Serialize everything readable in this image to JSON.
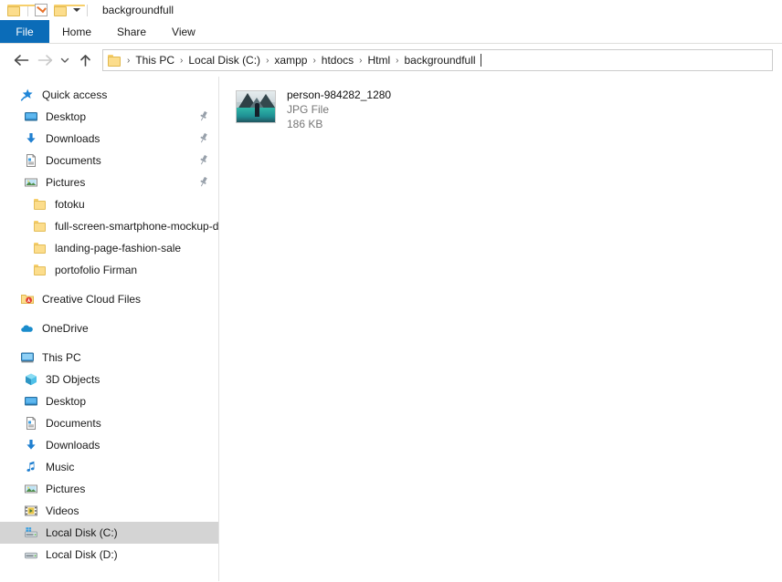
{
  "titlebar": {
    "title": "backgroundfull",
    "quick_access_icons": [
      "folder-icon",
      "properties-checkbox-icon",
      "folder-icon"
    ],
    "customize_label": ""
  },
  "ribbon": {
    "file_tab": "File",
    "tabs": [
      "Home",
      "Share",
      "View"
    ],
    "file_tab_color": "#0b6cb8"
  },
  "address": {
    "back_label": "Back",
    "forward_label": "Forward",
    "recent_label": "Recent locations",
    "up_label": "Up",
    "separator": "›",
    "crumbs": [
      "This PC",
      "Local Disk (C:)",
      "xampp",
      "htdocs",
      "Html",
      "backgroundfull"
    ]
  },
  "sidebar": {
    "quick_access": {
      "label": "Quick access",
      "icon": "star-icon",
      "items": [
        {
          "label": "Desktop",
          "icon": "desktop-icon",
          "pinned": true
        },
        {
          "label": "Downloads",
          "icon": "download-arrow-icon",
          "pinned": true
        },
        {
          "label": "Documents",
          "icon": "document-icon",
          "pinned": true
        },
        {
          "label": "Pictures",
          "icon": "pictures-icon",
          "pinned": true
        },
        {
          "label": "fotoku",
          "icon": "folder-icon",
          "pinned": false
        },
        {
          "label": "full-screen-smartphone-mockup-d",
          "icon": "folder-icon",
          "pinned": false
        },
        {
          "label": "landing-page-fashion-sale",
          "icon": "folder-icon",
          "pinned": false
        },
        {
          "label": "portofolio Firman",
          "icon": "folder-icon",
          "pinned": false
        }
      ]
    },
    "creative_cloud": {
      "label": "Creative Cloud Files",
      "icon": "creative-cloud-folder-icon"
    },
    "onedrive": {
      "label": "OneDrive",
      "icon": "cloud-icon"
    },
    "this_pc": {
      "label": "This PC",
      "icon": "computer-icon",
      "items": [
        {
          "label": "3D Objects",
          "icon": "3d-objects-icon"
        },
        {
          "label": "Desktop",
          "icon": "desktop-icon"
        },
        {
          "label": "Documents",
          "icon": "document-icon"
        },
        {
          "label": "Downloads",
          "icon": "download-arrow-icon"
        },
        {
          "label": "Music",
          "icon": "music-note-icon"
        },
        {
          "label": "Pictures",
          "icon": "pictures-icon"
        },
        {
          "label": "Videos",
          "icon": "videos-icon"
        },
        {
          "label": "Local Disk (C:)",
          "icon": "system-drive-icon",
          "selected": true
        },
        {
          "label": "Local Disk (D:)",
          "icon": "drive-icon",
          "selected": false
        }
      ]
    },
    "selection_color": "#d4d4d4"
  },
  "content": {
    "files": [
      {
        "name": "person-984282_1280",
        "type": "JPG File",
        "size": "186 KB",
        "thumbnail": "lake-mountain-photo-thumbnail"
      }
    ]
  }
}
